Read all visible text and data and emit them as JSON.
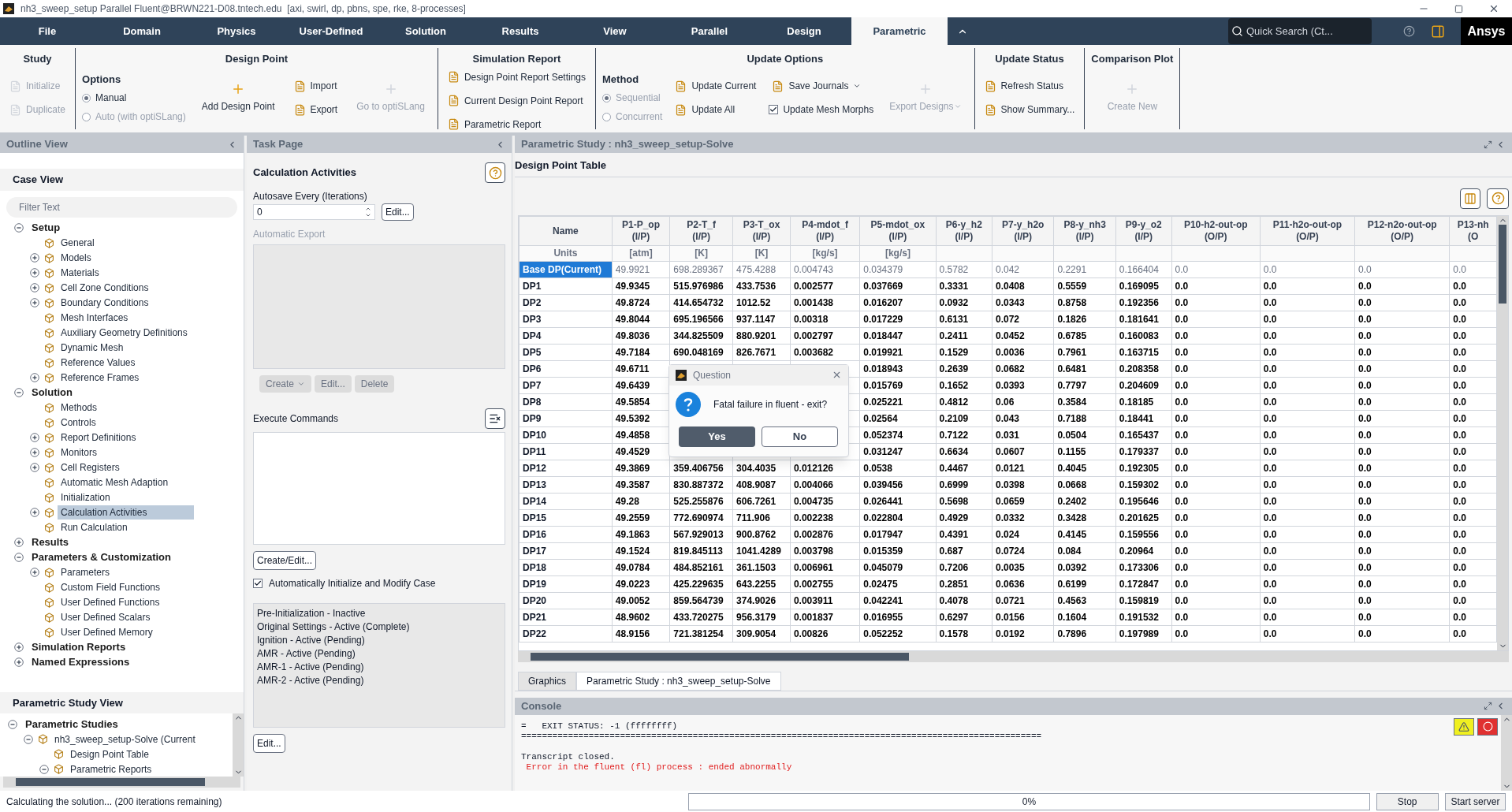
{
  "window": {
    "title": "nh3_sweep_setup Parallel Fluent@BRWN221-D08.tntech.edu  [axi, swirl, dp, pbns, spe, rke, 8-processes]"
  },
  "menu_tabs": [
    {
      "label": "File",
      "selected": false
    },
    {
      "label": "Domain",
      "selected": false
    },
    {
      "label": "Physics",
      "selected": false
    },
    {
      "label": "User-Defined",
      "selected": false
    },
    {
      "label": "Solution",
      "selected": false
    },
    {
      "label": "Results",
      "selected": false
    },
    {
      "label": "View",
      "selected": false
    },
    {
      "label": "Parallel",
      "selected": false
    },
    {
      "label": "Design",
      "selected": false
    },
    {
      "label": "Parametric",
      "selected": true
    }
  ],
  "search": {
    "placeholder": "Quick Search (Ct..."
  },
  "logo": "Ansys",
  "ribbon": [
    {
      "title": "Study",
      "columns": [
        [
          {
            "kind": "button",
            "label": "Initialize",
            "disabled": true
          },
          {
            "kind": "button",
            "label": "Duplicate",
            "disabled": true
          }
        ]
      ]
    },
    {
      "title": "Design Point",
      "columns": [
        [
          {
            "kind": "heading",
            "label": "Options"
          },
          {
            "kind": "radio",
            "label": "Manual",
            "selected": true,
            "disabled": false
          },
          {
            "kind": "radio",
            "label": "Auto (with optiSLang)",
            "selected": false,
            "disabled": true
          }
        ],
        [
          {
            "kind": "big-button",
            "label": "Add Design Point",
            "disabled": false
          }
        ],
        [
          {
            "kind": "button",
            "label": "Import",
            "disabled": false
          },
          {
            "kind": "button",
            "label": "Export",
            "disabled": false
          }
        ],
        [
          {
            "kind": "big-button",
            "label": "Go to optiSLang",
            "disabled": true
          }
        ]
      ]
    },
    {
      "title": "Simulation Report",
      "columns": [
        [
          {
            "kind": "button",
            "label": "Design Point Report Settings",
            "disabled": false
          },
          {
            "kind": "button",
            "label": "Current Design Point Report",
            "disabled": false
          },
          {
            "kind": "button",
            "label": "Parametric Report",
            "disabled": false
          }
        ]
      ]
    },
    {
      "title": "Update Options",
      "columns": [
        [
          {
            "kind": "heading",
            "label": "Method"
          },
          {
            "kind": "radio",
            "label": "Sequential",
            "selected": true,
            "disabled": true
          },
          {
            "kind": "radio",
            "label": "Concurrent",
            "selected": false,
            "disabled": true
          }
        ],
        [
          {
            "kind": "button",
            "label": "Update Current",
            "disabled": false
          },
          {
            "kind": "button",
            "label": "Update All",
            "disabled": false
          }
        ],
        [
          {
            "kind": "button",
            "label": "Save Journals",
            "disabled": false,
            "menu": true
          },
          {
            "kind": "checkbox",
            "label": "Update Mesh Morphs",
            "checked": true
          }
        ],
        [
          {
            "kind": "big-button",
            "label": "Export Designs",
            "disabled": true,
            "menu": true
          }
        ]
      ]
    },
    {
      "title": "Update Status",
      "columns": [
        [
          {
            "kind": "button",
            "label": "Refresh Status",
            "disabled": false
          },
          {
            "kind": "button",
            "label": "Show Summary...",
            "disabled": false
          }
        ]
      ]
    },
    {
      "title": "Comparison Plot",
      "columns": [
        [
          {
            "kind": "big-button",
            "label": "Create New",
            "disabled": true
          }
        ]
      ]
    }
  ],
  "outline": {
    "header": "Outline View",
    "title": "Case View",
    "filter_placeholder": "Filter Text",
    "tree": [
      {
        "label": "Setup",
        "expanded": true,
        "selected": false,
        "children": [
          {
            "label": "General",
            "selected": false
          },
          {
            "label": "Models",
            "expanded": false,
            "selected": false
          },
          {
            "label": "Materials",
            "expanded": false,
            "selected": false
          },
          {
            "label": "Cell Zone Conditions",
            "expanded": false,
            "selected": false
          },
          {
            "label": "Boundary Conditions",
            "expanded": false,
            "selected": false
          },
          {
            "label": "Mesh Interfaces",
            "selected": false
          },
          {
            "label": "Auxiliary Geometry Definitions",
            "selected": false
          },
          {
            "label": "Dynamic Mesh",
            "selected": false
          },
          {
            "label": "Reference Values",
            "selected": false
          },
          {
            "label": "Reference Frames",
            "expanded": false,
            "selected": false
          }
        ]
      },
      {
        "label": "Solution",
        "expanded": true,
        "selected": false,
        "children": [
          {
            "label": "Methods",
            "selected": false
          },
          {
            "label": "Controls",
            "selected": false
          },
          {
            "label": "Report Definitions",
            "expanded": false,
            "selected": false
          },
          {
            "label": "Monitors",
            "expanded": false,
            "selected": false
          },
          {
            "label": "Cell Registers",
            "expanded": false,
            "selected": false
          },
          {
            "label": "Automatic Mesh Adaption",
            "selected": false
          },
          {
            "label": "Initialization",
            "selected": false
          },
          {
            "label": "Calculation Activities",
            "expanded": false,
            "selected": true
          },
          {
            "label": "Run Calculation",
            "selected": false
          }
        ]
      },
      {
        "label": "Results",
        "expanded": false,
        "selected": false
      },
      {
        "label": "Parameters & Customization",
        "expanded": true,
        "selected": false,
        "children": [
          {
            "label": "Parameters",
            "expanded": false,
            "selected": false
          },
          {
            "label": "Custom Field Functions",
            "selected": false
          },
          {
            "label": "User Defined Functions",
            "selected": false
          },
          {
            "label": "User Defined Scalars",
            "selected": false
          },
          {
            "label": "User Defined Memory",
            "selected": false
          }
        ]
      },
      {
        "label": "Simulation Reports",
        "expanded": false,
        "selected": false
      },
      {
        "label": "Named Expressions",
        "expanded": false,
        "selected": false
      }
    ]
  },
  "parametric_view": {
    "title": "Parametric Study View",
    "tree": [
      {
        "label": "Parametric Studies",
        "expanded": true,
        "selected": false,
        "children": [
          {
            "label": "nh3_sweep_setup-Solve (Current",
            "expanded": true,
            "selected": false,
            "children": [
              {
                "label": "Design Point Table",
                "selected": false
              },
              {
                "label": "Parametric Reports",
                "expanded": true,
                "selected": false
              }
            ]
          }
        ]
      }
    ]
  },
  "task_page": {
    "header": "Task Page",
    "title": "Calculation Activities",
    "autosave_label": "Autosave Every (Iterations)",
    "autosave_value": "0",
    "autosave_edit": "Edit...",
    "export_label": "Automatic Export",
    "export_buttons": [
      {
        "label": "Create",
        "disabled": true,
        "menu": true
      },
      {
        "label": "Edit...",
        "disabled": true
      },
      {
        "label": "Delete",
        "disabled": true
      }
    ],
    "commands_label": "Execute Commands",
    "commands_button": "Create/Edit...",
    "auto_init": {
      "label": "Automatically Initialize and Modify Case",
      "checked": true
    },
    "activities": [
      "Pre-Initialization - Inactive",
      "Original Settings - Active (Complete)",
      "Ignition - Active (Pending)",
      "AMR - Active (Pending)",
      "AMR-1 - Active (Pending)",
      "AMR-2 - Active (Pending)"
    ],
    "activities_button": "Edit..."
  },
  "study": {
    "header": "Parametric Study : nh3_sweep_setup-Solve",
    "table_title": "Design Point Table",
    "name_header": "Name",
    "units_label": "Units",
    "columns": [
      {
        "name": "P1-P_op",
        "io": "(I/P)",
        "unit": "[atm]"
      },
      {
        "name": "P2-T_f",
        "io": "(I/P)",
        "unit": "[K]"
      },
      {
        "name": "P3-T_ox",
        "io": "(I/P)",
        "unit": "[K]"
      },
      {
        "name": "P4-mdot_f",
        "io": "(I/P)",
        "unit": "[kg/s]"
      },
      {
        "name": "P5-mdot_ox",
        "io": "(I/P)",
        "unit": "[kg/s]"
      },
      {
        "name": "P6-y_h2",
        "io": "(I/P)"
      },
      {
        "name": "P7-y_h2o",
        "io": "(I/P)"
      },
      {
        "name": "P8-y_nh3",
        "io": "(I/P)"
      },
      {
        "name": "P9-y_o2",
        "io": "(I/P)"
      },
      {
        "name": "P10-h2-out-op",
        "io": "(O/P)"
      },
      {
        "name": "P11-h2o-out-op",
        "io": "(O/P)"
      },
      {
        "name": "P12-n2o-out-op",
        "io": "(O/P)"
      },
      {
        "name": "P13-nh",
        "io": "(O"
      }
    ],
    "rows": [
      {
        "name": "Base DP(Current)",
        "current": true,
        "selected": true,
        "values": [
          "49.9921",
          "698.289367",
          "475.4288",
          "0.004743",
          "0.034379",
          "0.5782",
          "0.042",
          "0.2291",
          "0.166404",
          "0.0",
          "0.0",
          "0.0",
          "0.0"
        ]
      },
      {
        "name": "DP1",
        "current": false,
        "selected": false,
        "values": [
          "49.9345",
          "515.976986",
          "433.7536",
          "0.002577",
          "0.037669",
          "0.3331",
          "0.0408",
          "0.5559",
          "0.169095",
          "0.0",
          "0.0",
          "0.0",
          "0.0"
        ]
      },
      {
        "name": "DP2",
        "current": false,
        "selected": false,
        "values": [
          "49.8724",
          "414.654732",
          "1012.52",
          "0.001438",
          "0.016207",
          "0.0932",
          "0.0343",
          "0.8758",
          "0.192356",
          "0.0",
          "0.0",
          "0.0",
          "0.0"
        ]
      },
      {
        "name": "DP3",
        "current": false,
        "selected": false,
        "values": [
          "49.8044",
          "695.196566",
          "937.1147",
          "0.00318",
          "0.017229",
          "0.6131",
          "0.072",
          "0.1826",
          "0.181641",
          "0.0",
          "0.0",
          "0.0",
          "0.0"
        ]
      },
      {
        "name": "DP4",
        "current": false,
        "selected": false,
        "values": [
          "49.8036",
          "344.825509",
          "880.9201",
          "0.002797",
          "0.018447",
          "0.2411",
          "0.0452",
          "0.6785",
          "0.160083",
          "0.0",
          "0.0",
          "0.0",
          "0.0"
        ]
      },
      {
        "name": "DP5",
        "current": false,
        "selected": false,
        "values": [
          "49.7184",
          "690.048169",
          "826.7671",
          "0.003682",
          "0.019921",
          "0.1529",
          "0.0036",
          "0.7961",
          "0.163715",
          "0.0",
          "0.0",
          "0.0",
          "0.0"
        ]
      },
      {
        "name": "DP6",
        "current": false,
        "selected": false,
        "values": [
          "49.6711"
        ],
        "values_after_dialog": [
          "0.018943",
          "0.2639",
          "0.0682",
          "0.6481",
          "0.208358",
          "0.0",
          "0.0",
          "0.0",
          "0.0"
        ]
      },
      {
        "name": "DP7",
        "current": false,
        "selected": false,
        "values": [
          "49.6439"
        ],
        "values_after_dialog": [
          "0.015769",
          "0.1652",
          "0.0393",
          "0.7797",
          "0.204609",
          "0.0",
          "0.0",
          "0.0",
          "0.0"
        ]
      },
      {
        "name": "DP8",
        "current": false,
        "selected": false,
        "values": [
          "49.5854"
        ],
        "values_after_dialog": [
          "0.025221",
          "0.4812",
          "0.06",
          "0.3584",
          "0.18185",
          "0.0",
          "0.0",
          "0.0",
          "0.0"
        ]
      },
      {
        "name": "DP9",
        "current": false,
        "selected": false,
        "values": [
          "49.5392"
        ],
        "values_after_dialog": [
          "0.02564",
          "0.2109",
          "0.043",
          "0.7188",
          "0.18441",
          "0.0",
          "0.0",
          "0.0",
          "0.0"
        ]
      },
      {
        "name": "DP10",
        "current": false,
        "selected": false,
        "values": [
          "49.4858"
        ],
        "values_after_dialog": [
          "0.052374",
          "0.7122",
          "0.031",
          "0.0504",
          "0.165437",
          "0.0",
          "0.0",
          "0.0",
          "0.0"
        ]
      },
      {
        "name": "DP11",
        "current": false,
        "selected": false,
        "values": [
          "49.4529"
        ],
        "values_after_dialog": [
          "0.031247",
          "0.6634",
          "0.0607",
          "0.1155",
          "0.179337",
          "0.0",
          "0.0",
          "0.0",
          "0.0"
        ]
      },
      {
        "name": "DP12",
        "current": false,
        "selected": false,
        "values": [
          "49.3869",
          "359.406756",
          "304.4035",
          "0.012126",
          "0.0538",
          "0.4467",
          "0.0121",
          "0.4045",
          "0.192305",
          "0.0",
          "0.0",
          "0.0",
          "0.0"
        ]
      },
      {
        "name": "DP13",
        "current": false,
        "selected": false,
        "values": [
          "49.3587",
          "830.887372",
          "408.9087",
          "0.004066",
          "0.039456",
          "0.6999",
          "0.0398",
          "0.0668",
          "0.159302",
          "0.0",
          "0.0",
          "0.0",
          "0.0"
        ]
      },
      {
        "name": "DP14",
        "current": false,
        "selected": false,
        "values": [
          "49.28",
          "525.255876",
          "606.7261",
          "0.004735",
          "0.026441",
          "0.5698",
          "0.0659",
          "0.2402",
          "0.195646",
          "0.0",
          "0.0",
          "0.0",
          "0.0"
        ]
      },
      {
        "name": "DP15",
        "current": false,
        "selected": false,
        "values": [
          "49.2559",
          "772.690974",
          "711.906",
          "0.002238",
          "0.022804",
          "0.4929",
          "0.0332",
          "0.3428",
          "0.201625",
          "0.0",
          "0.0",
          "0.0",
          "0.0"
        ]
      },
      {
        "name": "DP16",
        "current": false,
        "selected": false,
        "values": [
          "49.1863",
          "567.929013",
          "900.8762",
          "0.002876",
          "0.017947",
          "0.4391",
          "0.024",
          "0.4145",
          "0.159556",
          "0.0",
          "0.0",
          "0.0",
          "0.0"
        ]
      },
      {
        "name": "DP17",
        "current": false,
        "selected": false,
        "values": [
          "49.1524",
          "819.845113",
          "1041.4289",
          "0.003798",
          "0.015359",
          "0.687",
          "0.0724",
          "0.084",
          "0.20964",
          "0.0",
          "0.0",
          "0.0",
          "0.0"
        ]
      },
      {
        "name": "DP18",
        "current": false,
        "selected": false,
        "values": [
          "49.0784",
          "484.852161",
          "361.1503",
          "0.006961",
          "0.045079",
          "0.7206",
          "0.0035",
          "0.0392",
          "0.173306",
          "0.0",
          "0.0",
          "0.0",
          "0.0"
        ]
      },
      {
        "name": "DP19",
        "current": false,
        "selected": false,
        "values": [
          "49.0223",
          "425.229635",
          "643.2255",
          "0.002755",
          "0.02475",
          "0.2851",
          "0.0636",
          "0.6199",
          "0.172847",
          "0.0",
          "0.0",
          "0.0",
          "0.0"
        ]
      },
      {
        "name": "DP20",
        "current": false,
        "selected": false,
        "values": [
          "49.0052",
          "859.564739",
          "374.9026",
          "0.003911",
          "0.042241",
          "0.4078",
          "0.0721",
          "0.4563",
          "0.159819",
          "0.0",
          "0.0",
          "0.0",
          "0.0"
        ]
      },
      {
        "name": "DP21",
        "current": false,
        "selected": false,
        "values": [
          "48.9602",
          "433.720275",
          "956.3179",
          "0.001837",
          "0.016955",
          "0.6297",
          "0.0156",
          "0.1604",
          "0.191532",
          "0.0",
          "0.0",
          "0.0",
          "0.0"
        ]
      },
      {
        "name": "DP22",
        "current": false,
        "selected": false,
        "values": [
          "48.9156",
          "721.381254",
          "309.9054",
          "0.00826",
          "0.052252",
          "0.1578",
          "0.0192",
          "0.7896",
          "0.197989",
          "0.0",
          "0.0",
          "0.0",
          "0.0"
        ]
      }
    ]
  },
  "dialog": {
    "title": "Question",
    "message": "Fatal failure in fluent - exit?",
    "buttons": [
      {
        "label": "Yes",
        "default": true
      },
      {
        "label": "No",
        "default": false
      }
    ]
  },
  "view_tabs": [
    {
      "label": "Graphics",
      "selected": false
    },
    {
      "label": "Parametric Study : nh3_sweep_setup-Solve",
      "selected": true
    }
  ],
  "console": {
    "header": "Console",
    "lines": [
      {
        "kind": "normal",
        "text": "=   EXIT STATUS: -1 (ffffffff)"
      },
      {
        "kind": "normal",
        "text": "===================================================================================================="
      },
      {
        "kind": "blank"
      },
      {
        "kind": "normal",
        "text": "Transcript closed."
      },
      {
        "kind": "error",
        "text": " Error in the fluent (fl) process : ended abnormally"
      }
    ]
  },
  "status_bar": {
    "message": "Calculating the solution... (200 iterations remaining)",
    "progress": {
      "level": 0,
      "reading": "0%"
    },
    "buttons": [
      "Stop",
      "Start server"
    ]
  }
}
